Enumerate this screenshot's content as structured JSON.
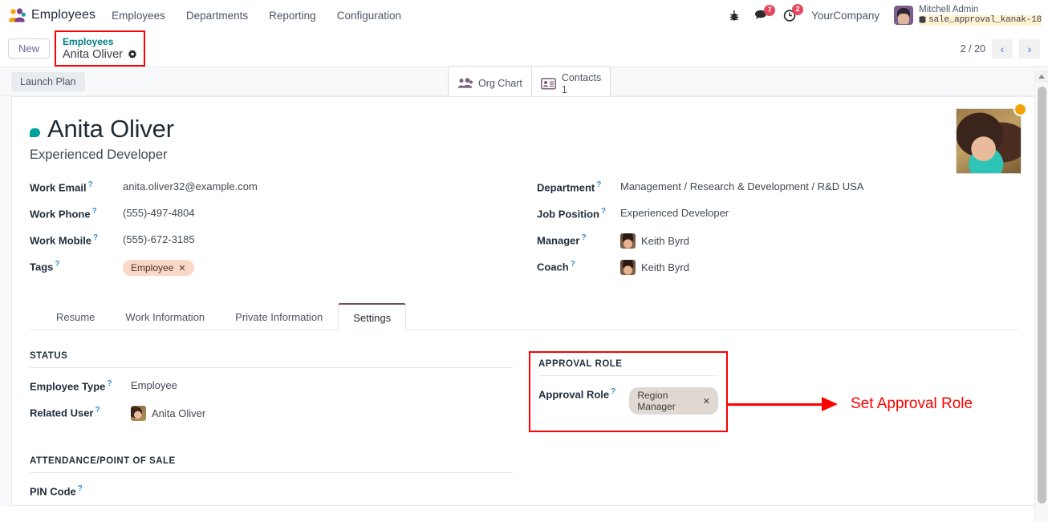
{
  "navbar": {
    "app_icon": "employees-app-icon",
    "brand": "Employees",
    "menu": [
      "Employees",
      "Departments",
      "Reporting",
      "Configuration"
    ],
    "bug_icon": "bug-icon",
    "messages_icon": "chat-bubble-icon",
    "messages_count": "7",
    "activities_icon": "clock-icon",
    "activities_count": "2",
    "company": "YourCompany",
    "user_name": "Mitchell Admin",
    "database_icon": "database-icon",
    "database": "sale_approval_kanak-18"
  },
  "control_panel": {
    "new_label": "New",
    "breadcrumb_parent": "Employees",
    "breadcrumb_current": "Anita Oliver",
    "gear_icon": "gear-icon",
    "stat_buttons": [
      {
        "icon": "org-chart-icon",
        "label": "Org Chart",
        "count": ""
      },
      {
        "icon": "contacts-card-icon",
        "label": "Contacts",
        "count": "1"
      }
    ],
    "pager_text": "2 / 20",
    "prev_icon": "chevron-left-icon",
    "next_icon": "chevron-right-icon"
  },
  "plan_bar": {
    "launch_plan_label": "Launch Plan"
  },
  "record": {
    "chat_icon": "chat-bubble-icon",
    "name": "Anita Oliver",
    "job_title": "Experienced Developer",
    "photo": "employee-photo",
    "status_color": "#f0a30a",
    "left_fields": [
      {
        "label": "Work Email",
        "value": "anita.oliver32@example.com",
        "type": "text"
      },
      {
        "label": "Work Phone",
        "value": "(555)-497-4804",
        "type": "text"
      },
      {
        "label": "Work Mobile",
        "value": "(555)-672-3185",
        "type": "text"
      },
      {
        "label": "Tags",
        "value": "Employee",
        "type": "tag"
      }
    ],
    "right_fields": [
      {
        "label": "Department",
        "value": "Management / Research & Development / R&D USA",
        "type": "text"
      },
      {
        "label": "Job Position",
        "value": "Experienced Developer",
        "type": "text"
      },
      {
        "label": "Manager",
        "value": "Keith Byrd",
        "type": "avatar"
      },
      {
        "label": "Coach",
        "value": "Keith Byrd",
        "type": "avatar"
      }
    ]
  },
  "notebook": {
    "tabs": [
      "Resume",
      "Work Information",
      "Private Information",
      "Settings"
    ],
    "active_tab": "Settings"
  },
  "settings_tab": {
    "status_group": {
      "title": "STATUS",
      "fields": [
        {
          "label": "Employee Type",
          "value": "Employee",
          "type": "text"
        },
        {
          "label": "Related User",
          "value": "Anita Oliver",
          "type": "avatar"
        }
      ]
    },
    "attendance_group": {
      "title": "ATTENDANCE/POINT OF SALE",
      "fields": [
        {
          "label": "PIN Code",
          "value": "",
          "type": "text"
        }
      ]
    },
    "approval_group": {
      "title": "APPROVAL ROLE",
      "fields": [
        {
          "label": "Approval Role",
          "value": "Region Manager",
          "type": "tag"
        }
      ]
    }
  },
  "annotation": {
    "text": "Set Approval Role",
    "color": "#ff0000"
  },
  "scrollbar": {
    "up_icon": "scroll-up-arrow-icon"
  }
}
